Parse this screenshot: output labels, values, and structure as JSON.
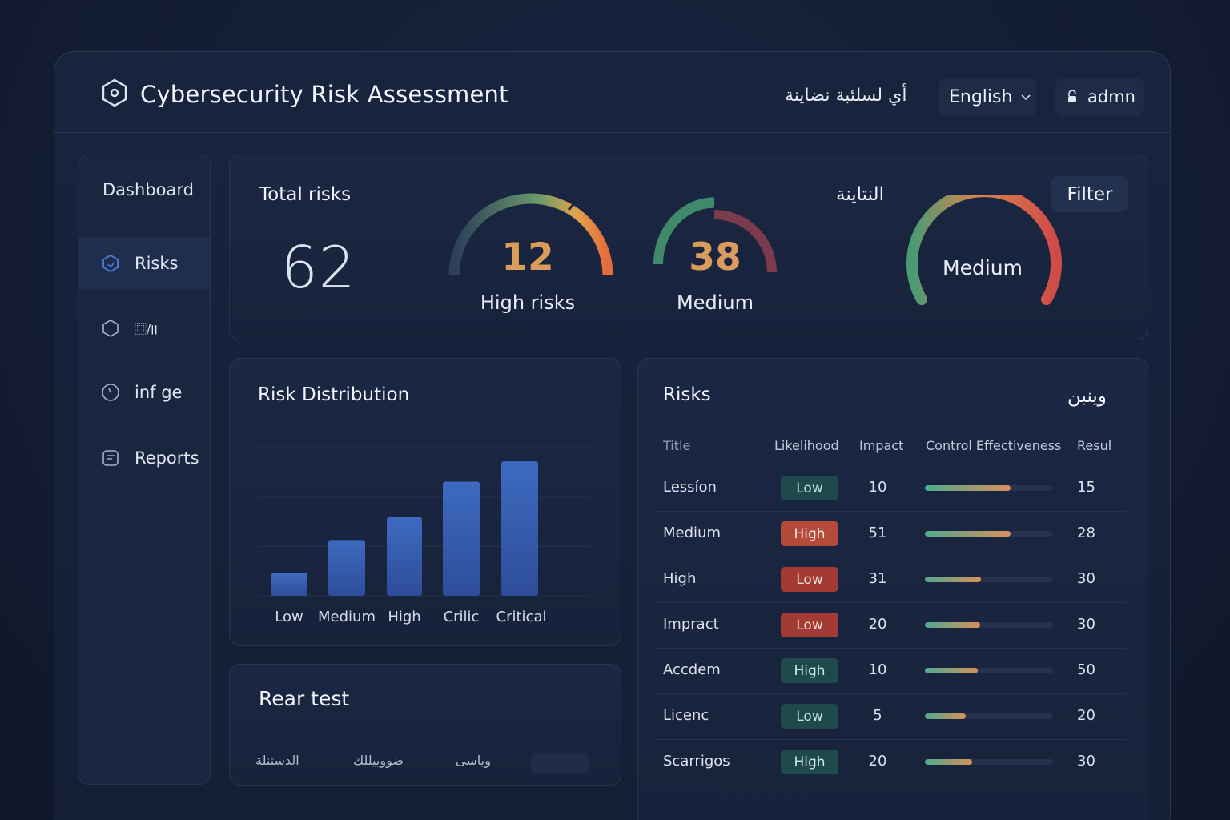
{
  "header": {
    "title": "Cybersecurity Risk Assessment",
    "arabic_text": "أي لسلئبة نضاينة",
    "language": "English",
    "user": "admn"
  },
  "sidebar": {
    "items": [
      {
        "label": "Dashboard",
        "icon": "none"
      },
      {
        "label": "Risks",
        "icon": "hexagon-icon"
      },
      {
        "label": "⿴/׀׀",
        "icon": "hexagon-icon"
      },
      {
        "label": "inf ge",
        "icon": "clock-icon"
      },
      {
        "label": "Reports",
        "icon": "document-icon"
      }
    ]
  },
  "summary": {
    "total_label": "Total risks",
    "total_value": "62",
    "high_value": "12",
    "high_label": "High risks",
    "medium_value": "38",
    "medium_label": "Medium",
    "arabic_label": "النتاينة",
    "overall_label": "Medium",
    "filter_label": "Filter"
  },
  "distribution": {
    "title": "Risk Distribution",
    "chart_data": {
      "type": "bar",
      "categories": [
        "Low",
        "Medium",
        "High",
        "Crilic",
        "Critical"
      ],
      "values": [
        9,
        22,
        31,
        45,
        53
      ],
      "ylim": [
        0,
        60
      ],
      "grid": true
    }
  },
  "recent": {
    "title": "Rear test",
    "items": [
      "الدستنلة",
      "ضووييللك",
      "وياسى"
    ]
  },
  "risks_table": {
    "title": "Risks",
    "arabic_title": "وينبن",
    "columns": [
      "Title",
      "Likelihood",
      "Impact",
      "Control Effectiveness",
      "Resul"
    ],
    "rows": [
      {
        "title": "Lessíon",
        "likelihood": "Low",
        "impact": "10",
        "effectiveness": 0.67,
        "result": "15",
        "style": "low"
      },
      {
        "title": "Medium",
        "likelihood": "High",
        "impact": "51",
        "effectiveness": 0.67,
        "result": "28",
        "style": "high"
      },
      {
        "title": "High",
        "likelihood": "Low",
        "impact": "31",
        "effectiveness": 0.44,
        "result": "30",
        "style": "lowred"
      },
      {
        "title": "Impract",
        "likelihood": "Low",
        "impact": "20",
        "effectiveness": 0.43,
        "result": "30",
        "style": "lowred"
      },
      {
        "title": "Accdem",
        "likelihood": "High",
        "impact": "10",
        "effectiveness": 0.41,
        "result": "50",
        "style": "highgreen"
      },
      {
        "title": "Licenc",
        "likelihood": "Low",
        "impact": "5",
        "effectiveness": 0.32,
        "result": "20",
        "style": "low"
      },
      {
        "title": "Scarrigos",
        "likelihood": "High",
        "impact": "20",
        "effectiveness": 0.37,
        "result": "30",
        "style": "highgreen"
      }
    ]
  },
  "colors": {
    "accent_orange": "#d99c5c",
    "bar_blue": "#3b63b8",
    "high_red": "#b44a3a",
    "low_green": "#1f4a4c"
  }
}
